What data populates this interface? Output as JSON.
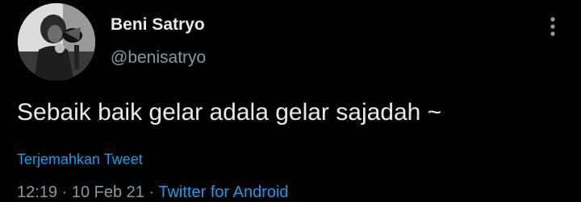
{
  "tweet": {
    "display_name": "Beni Satryo",
    "handle": "@benisatryo",
    "text": "Sebaik baik gelar adala gelar sajadah ~",
    "translate_label": "Terjemahkan Tweet",
    "time": "12:19",
    "date": "10 Feb 21",
    "separator": "·",
    "source": "Twitter for Android",
    "more_icon": "vertical-ellipsis-icon"
  },
  "colors": {
    "background": "#000000",
    "primary_text": "#e7e9ea",
    "secondary_text": "#8b98a5",
    "link": "#1d9bf0"
  }
}
